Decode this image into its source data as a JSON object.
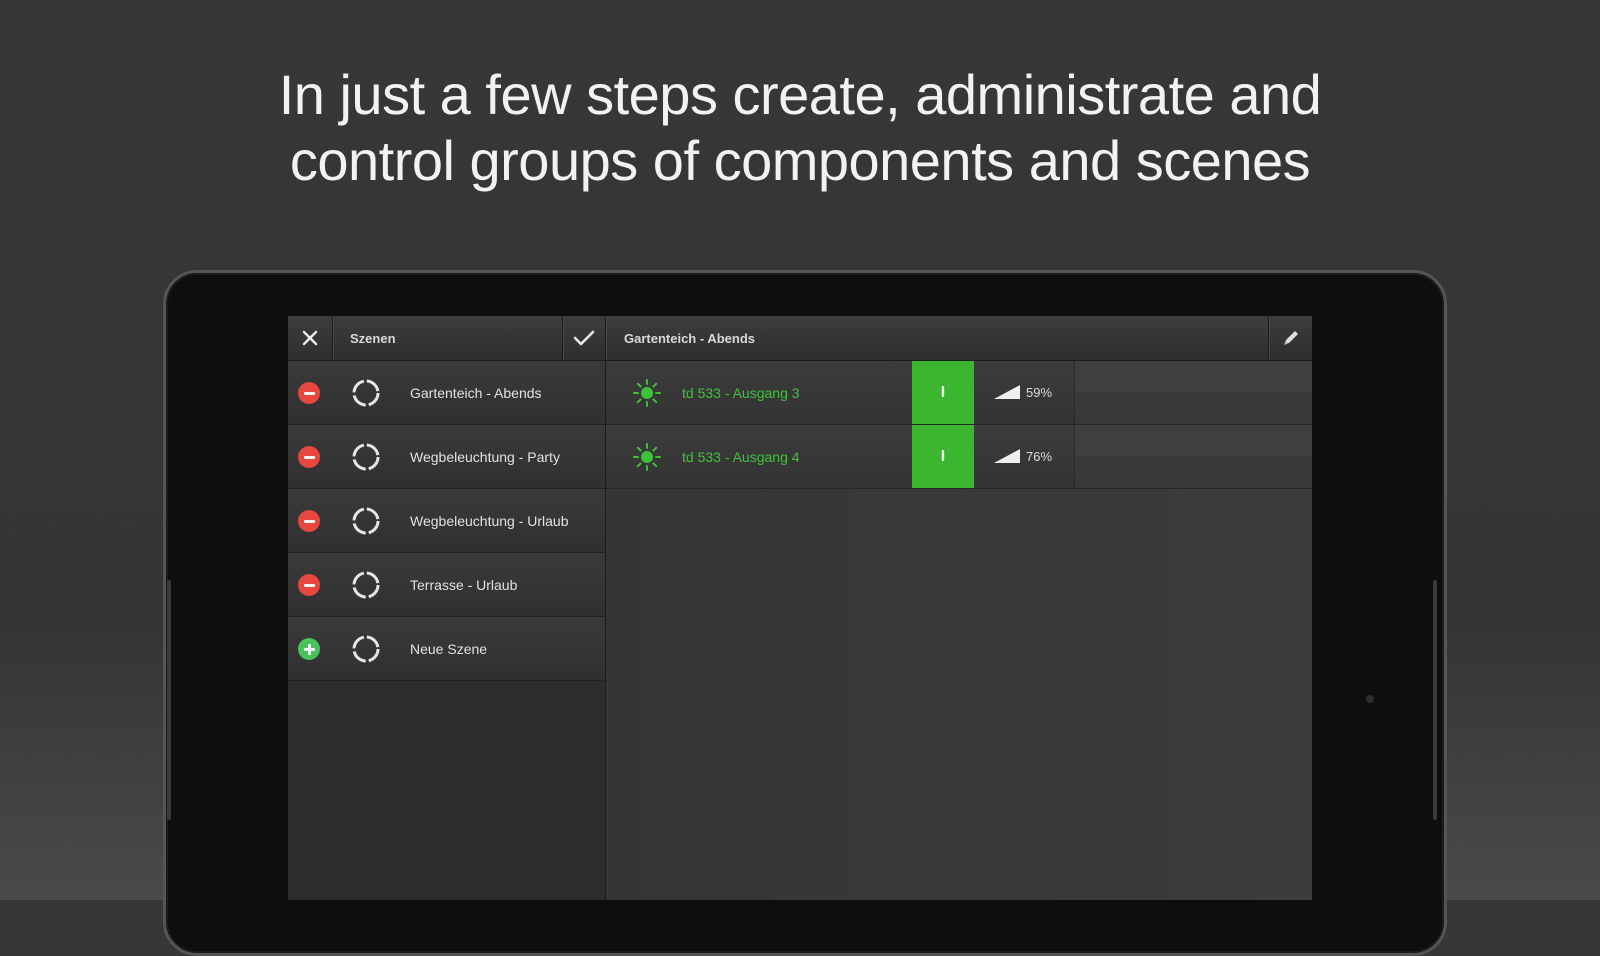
{
  "headline": {
    "line1": "In just a few steps create, administrate and",
    "line2": "control groups of components and scenes"
  },
  "colors": {
    "accent_green": "#3cb62e",
    "label_green": "#3fc23a",
    "delete_red": "#e8463f",
    "add_green": "#46c45a"
  },
  "toolbar": {
    "close_icon": "close-icon",
    "left_title": "Szenen",
    "confirm_icon": "checkmark-icon",
    "right_title": "Gartenteich - Abends",
    "edit_icon": "pencil-icon"
  },
  "scenes": [
    {
      "label": "Gartenteich - Abends",
      "action": "remove"
    },
    {
      "label": "Wegbeleuchtung - Party",
      "action": "remove"
    },
    {
      "label": "Wegbeleuchtung - Urlaub",
      "action": "remove"
    },
    {
      "label": "Terrasse - Urlaub",
      "action": "remove"
    },
    {
      "label": "Neue Szene",
      "action": "add"
    }
  ],
  "components": [
    {
      "label": "td 533 - Ausgang 3",
      "switch": "I",
      "dim_value": "59%"
    },
    {
      "label": "td 533 - Ausgang 4",
      "switch": "I",
      "dim_value": "76%"
    }
  ]
}
